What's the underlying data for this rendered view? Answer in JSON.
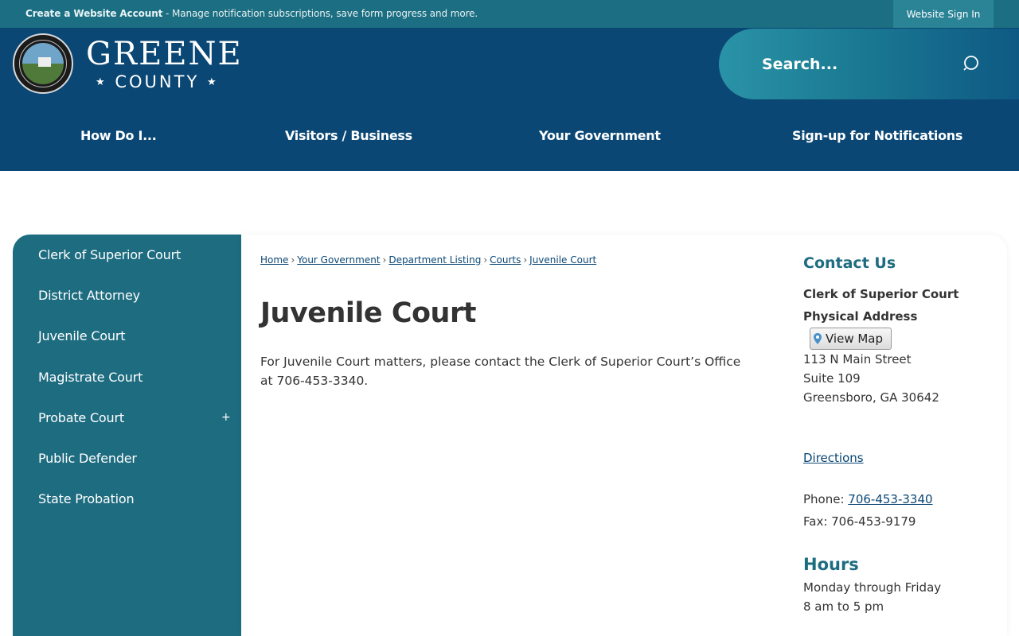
{
  "topbar": {
    "create_label": "Create a Website Account",
    "message": " - Manage notification subscriptions, save form progress and more.",
    "signin_label": "Website Sign In"
  },
  "logo": {
    "line1": "GREENE",
    "line2": "COUNTY",
    "seal_text": "GREENE COUNTY GEORGIA"
  },
  "search": {
    "placeholder": "Search..."
  },
  "nav": {
    "items": [
      "How Do I...",
      "Visitors / Business",
      "Your Government",
      "Sign-up for Notifications"
    ]
  },
  "sidebar": {
    "items": [
      {
        "label": "Clerk of Superior Court"
      },
      {
        "label": "District Attorney"
      },
      {
        "label": "Juvenile Court"
      },
      {
        "label": "Magistrate Court"
      },
      {
        "label": "Probate Court",
        "expand": "+"
      },
      {
        "label": "Public Defender"
      },
      {
        "label": "State Probation"
      }
    ]
  },
  "breadcrumb": {
    "items": [
      "Home",
      "Your Government",
      "Department Listing",
      "Courts",
      "Juvenile Court"
    ],
    "separator": "›"
  },
  "main": {
    "title": "Juvenile Court",
    "body": "For Juvenile Court matters, please contact the Clerk of Superior Court’s Office at 706-453-3340."
  },
  "contact": {
    "heading": "Contact Us",
    "name": "Clerk of Superior Court",
    "address_label": "Physical Address",
    "view_map": "View Map",
    "street": "113 N Main Street",
    "suite": "Suite 109",
    "city": "Greensboro, GA 30642",
    "directions": "Directions",
    "phone_label": "Phone: ",
    "phone": "706-453-3340",
    "fax": "Fax: 706-453-9179",
    "hours_heading": "Hours",
    "hours_days": "Monday through Friday",
    "hours_time": "8 am to 5 pm"
  },
  "colors": {
    "header": "#0a4774",
    "topbar": "#1c6f82",
    "sidebar": "#1e6c80",
    "link": "#0a4774"
  }
}
